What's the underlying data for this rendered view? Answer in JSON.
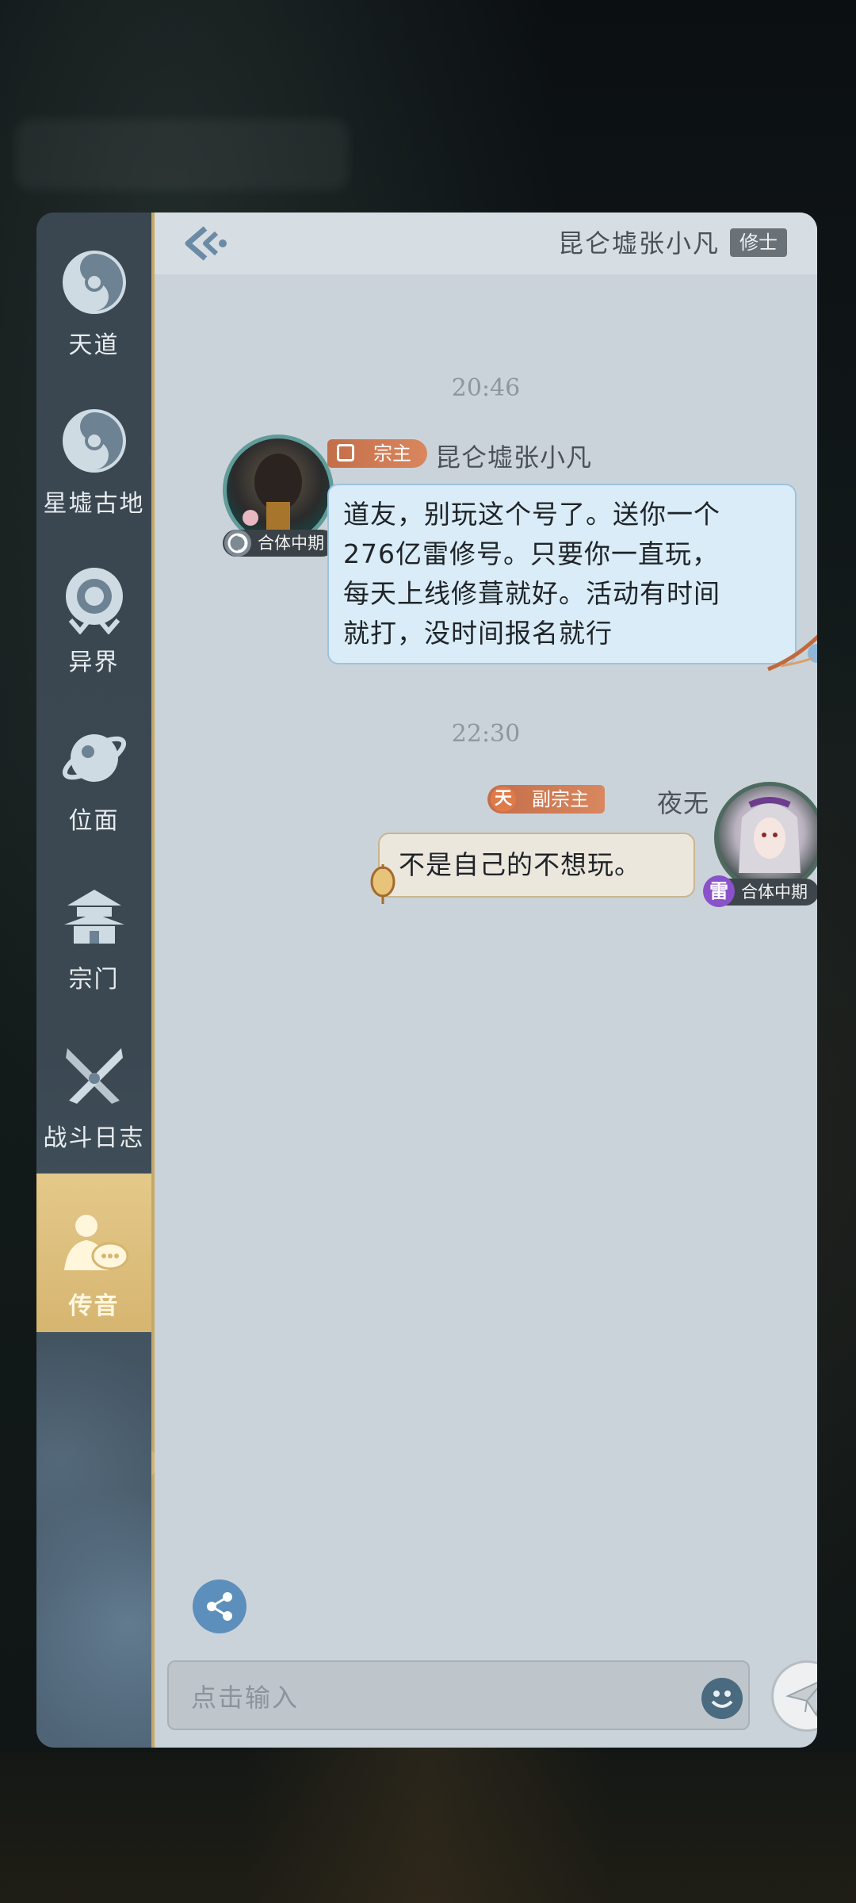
{
  "sidebar": {
    "items": [
      {
        "label": "天道",
        "icon": "taiji-swirl-icon"
      },
      {
        "label": "星墟古地",
        "icon": "taiji-swirl-icon"
      },
      {
        "label": "异界",
        "icon": "portal-ring-icon"
      },
      {
        "label": "位面",
        "icon": "planet-icon"
      },
      {
        "label": "宗门",
        "icon": "pagoda-icon"
      },
      {
        "label": "战斗日志",
        "icon": "crossed-swords-icon"
      },
      {
        "label": "传音",
        "icon": "messenger-chat-icon",
        "active": true
      }
    ]
  },
  "header": {
    "contact_name": "昆仑墟张小凡",
    "contact_tag": "修士",
    "back_icon": "back-arrow-icon"
  },
  "messages": [
    {
      "time": "20:46",
      "side": "left",
      "title_badge": "宗主",
      "sender": "昆仑墟张小凡",
      "rank": "合体中期",
      "lines": [
        "道友，别玩这个号了。送你一个",
        "276亿雷修号。只要你一直玩，",
        "每天上线修葺就好。活动有时间",
        "就打，没时间报名就行"
      ]
    },
    {
      "time": "22:30",
      "side": "right",
      "title_badge_prefix": "天",
      "title_badge": "副宗主",
      "sender": "夜无",
      "rank_prefix": "雷",
      "rank": "合体中期",
      "lines": [
        "不是自己的不想玩。"
      ]
    }
  ],
  "input": {
    "placeholder": "点击输入"
  },
  "colors": {
    "sidebar_active": "#d6b570",
    "left_bubble": "#d9ecf7",
    "right_bubble": "#ece7dd",
    "title_badge": "#c46e49",
    "thunder_badge": "#8a52c9"
  }
}
